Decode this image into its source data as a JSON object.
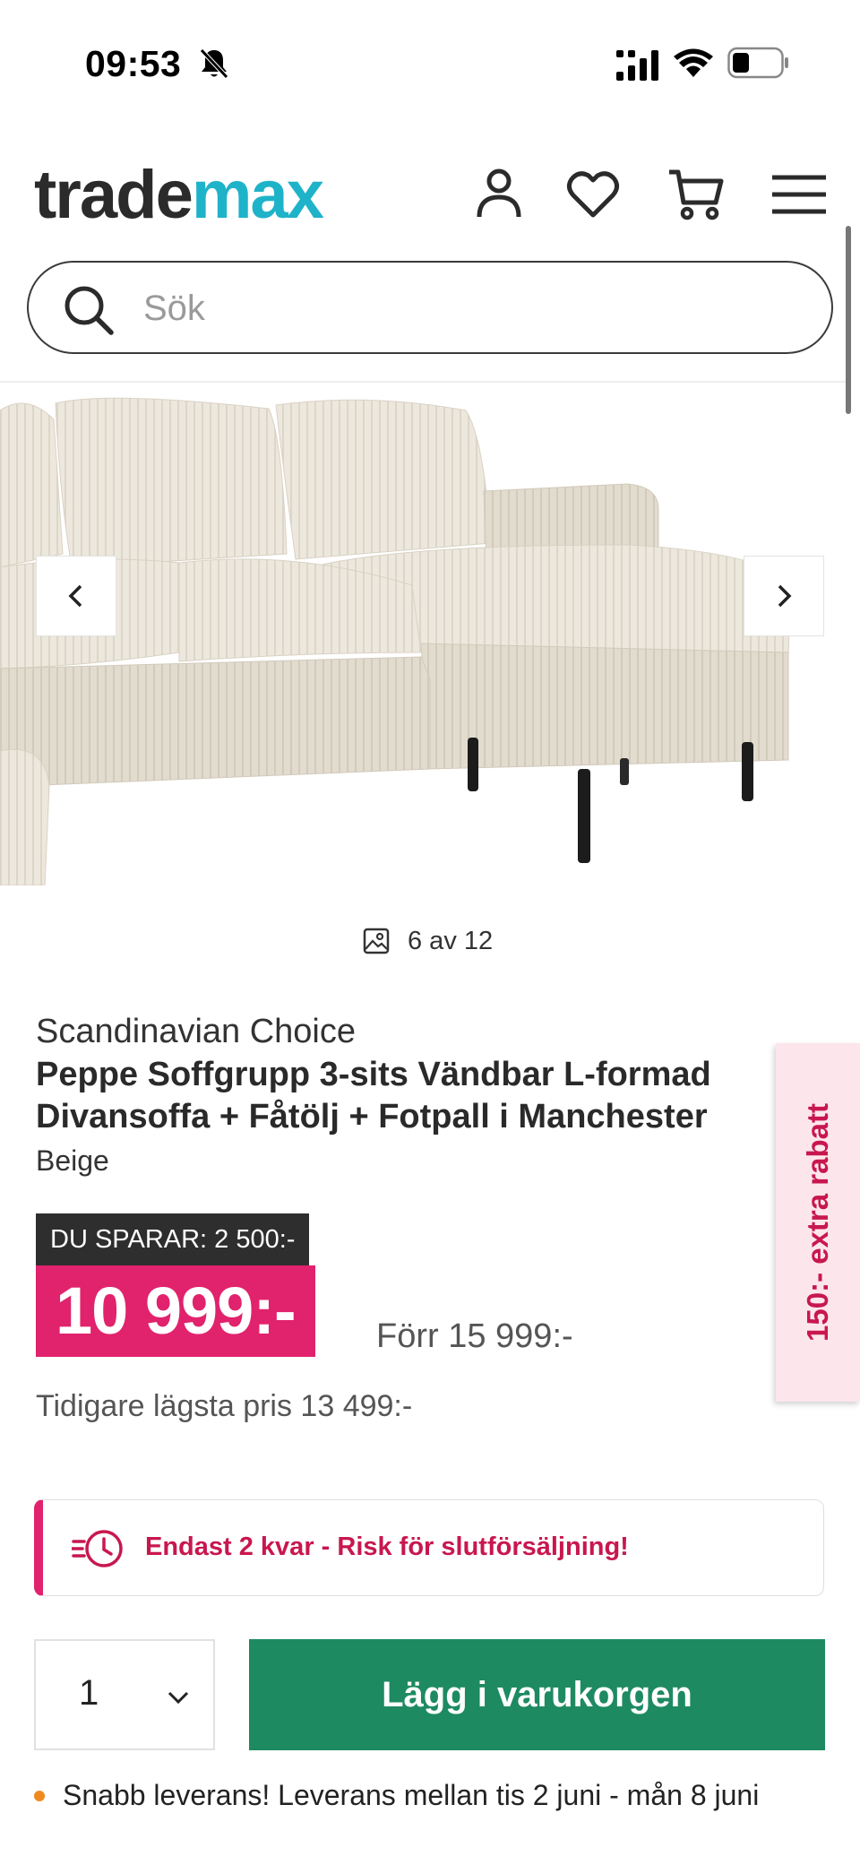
{
  "status_bar": {
    "time": "09:53"
  },
  "header": {
    "logo_part1": "trade",
    "logo_part2": "max",
    "icons": [
      "account-icon",
      "wishlist-heart-icon",
      "cart-icon",
      "hamburger-menu-icon"
    ]
  },
  "search": {
    "placeholder": "Sök",
    "value": ""
  },
  "gallery": {
    "counter": "6 av 12",
    "current": 6,
    "total": 12
  },
  "product": {
    "brand": "Scandinavian Choice",
    "title": "Peppe Soffgrupp 3-sits Vändbar L-formad Divansoffa + Fåtölj + Fotpall i Manchester",
    "variant": "Beige",
    "savings": "DU SPARAR: 2 500:-",
    "price": "10 999:-",
    "old_price": "Förr 15 999:-",
    "lowest_price": "Tidigare lägsta pris 13 499:-"
  },
  "side_promo": "150:- extra rabatt",
  "stock_warning": "Endast 2 kvar - Risk för slutförsäljning!",
  "purchase": {
    "quantity": "1",
    "add_to_cart_label": "Lägg i varukorgen"
  },
  "delivery": "Snabb leverans! Leverans mellan tis 2 juni - mån 8 juni",
  "colors": {
    "brand_teal": "#1fb3c9",
    "price_pink": "#e1226c",
    "cart_green": "#1e8a62",
    "bullet_orange": "#f08a1e"
  }
}
